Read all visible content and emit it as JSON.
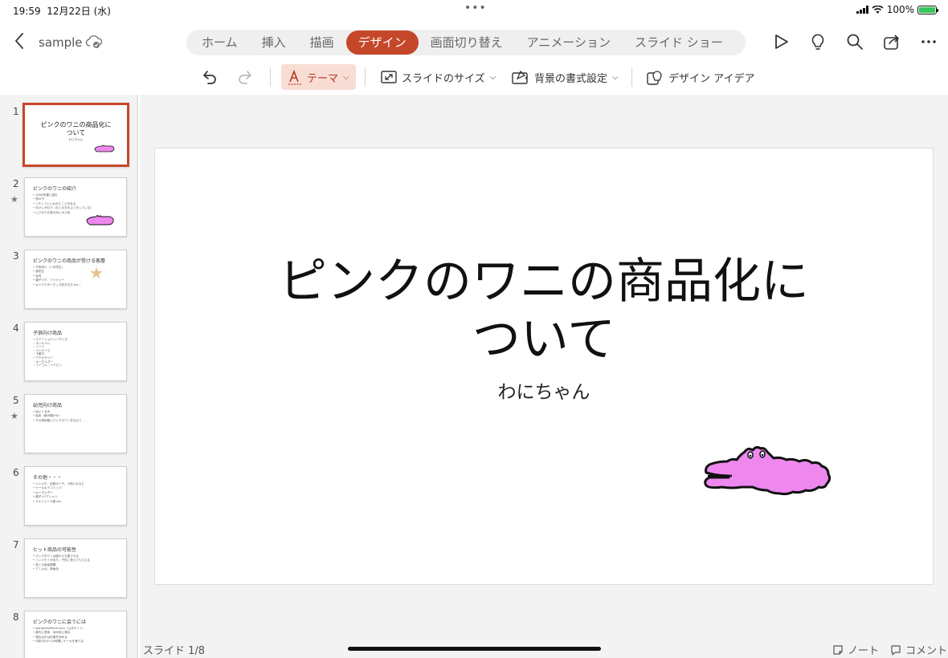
{
  "status_bar": {
    "time": "19:59",
    "date": "12月22日 (水)",
    "battery": "100%",
    "dots": "•••"
  },
  "top_bar": {
    "doc_name": "sample",
    "tabs": [
      "ホーム",
      "挿入",
      "描画",
      "デザイン",
      "画面切り替え",
      "アニメーション",
      "スライド ショー"
    ],
    "active_tab": "デザイン",
    "icons": [
      "play-icon",
      "lightbulb-icon",
      "search-icon",
      "share-icon",
      "more-icon"
    ]
  },
  "ribbon": {
    "theme_label": "テーマ",
    "slide_size_label": "スライドのサイズ",
    "background_label": "背景の書式設定",
    "design_ideas_label": "デザイン アイデア"
  },
  "thumbnails": [
    {
      "num": "1",
      "title": "ピンクのワニの商品化について",
      "subtitle": "わにちゃん",
      "lines": []
    },
    {
      "num": "2",
      "title": "ピンクのワニの紹介",
      "lines": [
        "• 19XX年春に誕生",
        "• 男の子",
        "• ツチノコといわれたことがある",
        "• おけしがだけ（おとの方をよくをしている）",
        "• いさなりお茶のみに大人気"
      ]
    },
    {
      "num": "3",
      "title": "ピンクのワニの商品が受ける客層",
      "lines": [
        "• 子供向け（～中学生）",
        "• 高校生",
        "• 女性",
        "• 親子ペア、ファミリー",
        "• キャラクターグッズ好きな方 etc..."
      ]
    },
    {
      "num": "4",
      "title": "子供向け商品",
      "lines": [
        "• ステーショナリーグッズ",
        "   ・ボールペン",
        "   ・ノート",
        "   ・ペンケース",
        "   ・下敷き",
        "• アクセサリー",
        "   ・キーホルダー",
        "   ・ヘアゴム・ヘアピン"
      ]
    },
    {
      "num": "5",
      "title": "幼児向け商品",
      "lines": [
        "• ぬいぐるみ",
        "• 絵本（読み聞かせ）",
        "• その他幼稚にピンクのワニを加えて．．．"
      ]
    },
    {
      "num": "6",
      "title": "その他・・・",
      "lines": [
        "• ハンカチ、化粧ポーチ、小物入れなど",
        "• ケーキ＆デコトップ",
        "• キーホルダー",
        "• 親子ペアTシャツ",
        "• スケジュール帳 etc."
      ]
    },
    {
      "num": "7",
      "title": "ヒット商品の可能性",
      "lines": [
        "• ピンクのワニは誰からも愛される",
        "• インパクトがあり、子供に覚えてもらえる",
        "• 多くの商品展開",
        "• アニメ化、映画化"
      ]
    },
    {
      "num": "8",
      "title": "ピンクのワニに会うには",
      "lines": [
        "• wanipinkofficial.com（公式サイト）",
        "• 都内に週末、休み前に現る",
        "• 場合は中は仕事を休める",
        "• 2時のおやつの時間にケーキを食べる"
      ]
    }
  ],
  "slide": {
    "title_line1": "ピンクのワニの商品化に",
    "title_line2": "ついて",
    "subtitle": "わにちゃん"
  },
  "footer": {
    "slide_counter": "スライド 1/8",
    "notes_label": "ノート",
    "comments_label": "コメント"
  },
  "colors": {
    "accent": "#c5472a",
    "croc_pink": "#ee88ee"
  }
}
